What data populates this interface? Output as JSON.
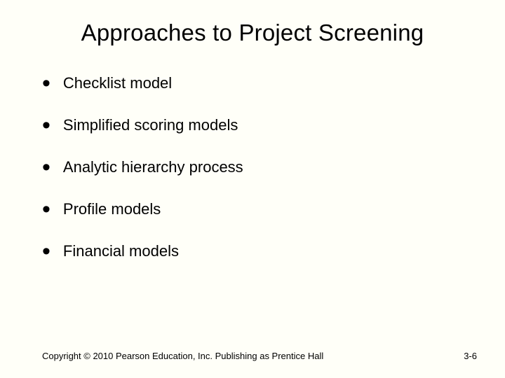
{
  "title": "Approaches to Project Screening",
  "items": [
    "Checklist model",
    "Simplified scoring models",
    "Analytic hierarchy process",
    "Profile models",
    "Financial models"
  ],
  "footer": {
    "copyright": "Copyright © 2010 Pearson Education, Inc. Publishing as Prentice Hall",
    "page": "3-6"
  }
}
